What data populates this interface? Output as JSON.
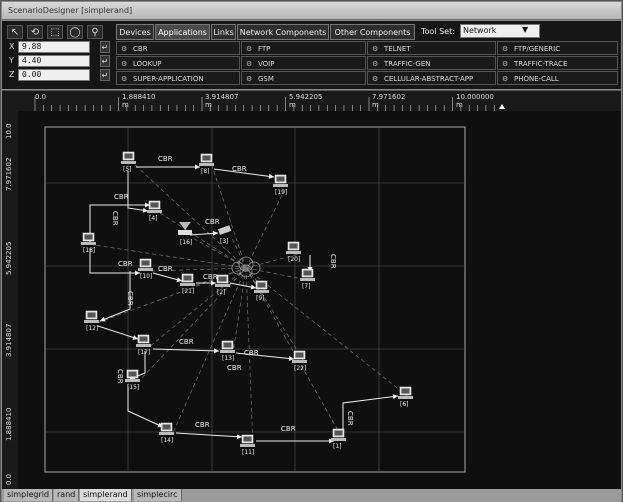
{
  "window": {
    "title": "ScenarioDesigner [simplerand]"
  },
  "toolbar": {
    "tools": [
      "arrow-tool-icon",
      "rotate-tool-icon",
      "rect-select-icon",
      "lasso-select-icon",
      "zoom-icon"
    ],
    "coords": {
      "x": "9.88",
      "y": "4.40",
      "z": "0.00",
      "x_label": "X",
      "y_label": "Y",
      "z_label": "Z",
      "enter": "↵"
    },
    "tabs": [
      "Devices",
      "Applications",
      "Links",
      "Network Components",
      "Other Components"
    ],
    "active_tab": "Applications",
    "toolset_label": "Tool Set:",
    "toolset_value": "Network",
    "components": [
      [
        "CBR",
        "FTP",
        "TELNET",
        "FTP/GENERIC"
      ],
      [
        "LOOKUP",
        "VOIP",
        "TRAFFIC-GEN",
        "TRAFFIC-TRACE"
      ],
      [
        "SUPER-APPLICATION",
        "GSM",
        "CELLULAR-ABSTRACT-APP",
        "PHONE-CALL"
      ]
    ]
  },
  "ruler": {
    "top": [
      "0.0",
      "1.888410",
      "3.914807",
      "5.942205",
      "7.971602",
      "10.000000"
    ],
    "top_unit": "m",
    "left": [
      "10.0",
      "7.971602",
      "5.942205",
      "3.914807",
      "1.888410",
      "0.0"
    ]
  },
  "scenario": {
    "nodes": [
      {
        "id": "1",
        "label": "[1]"
      },
      {
        "id": "2",
        "label": "[2]"
      },
      {
        "id": "3",
        "label": "[3]"
      },
      {
        "id": "4",
        "label": "[4]"
      },
      {
        "id": "5",
        "label": "[5]"
      },
      {
        "id": "6",
        "label": "[6]"
      },
      {
        "id": "7",
        "label": "[7]"
      },
      {
        "id": "8",
        "label": "[8]"
      },
      {
        "id": "9",
        "label": "[9]"
      },
      {
        "id": "10",
        "label": "[10]"
      },
      {
        "id": "11",
        "label": "[11]"
      },
      {
        "id": "12",
        "label": "[12]"
      },
      {
        "id": "13",
        "label": "[13]"
      },
      {
        "id": "14",
        "label": "[14]"
      },
      {
        "id": "15",
        "label": "[15]"
      },
      {
        "id": "16",
        "label": "[16]"
      },
      {
        "id": "17",
        "label": "[17]"
      },
      {
        "id": "18",
        "label": "[18]"
      },
      {
        "id": "19",
        "label": "[19]"
      },
      {
        "id": "20",
        "label": "[20]"
      },
      {
        "id": "21",
        "label": "[21]"
      },
      {
        "id": "22",
        "label": "[22]"
      }
    ],
    "app_label": "CBR"
  },
  "bottom_tabs": [
    "simplegrid",
    "rand",
    "simplerand",
    "simplecirc"
  ],
  "active_bottom_tab": "simplerand"
}
